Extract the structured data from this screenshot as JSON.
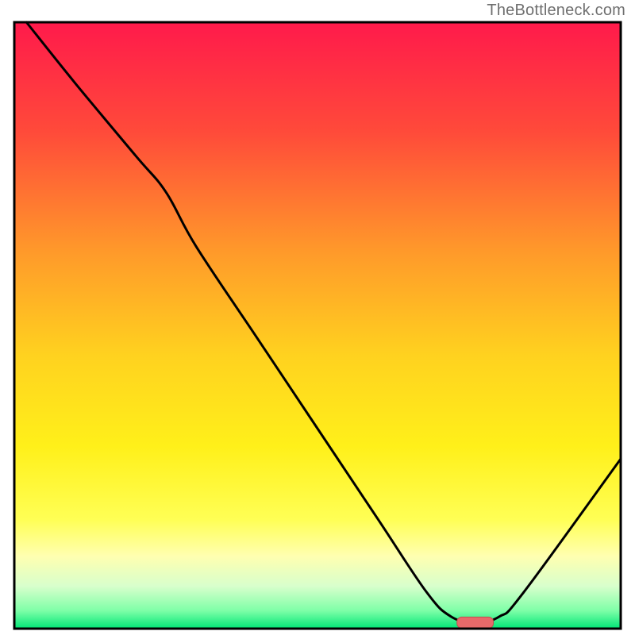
{
  "watermark": "TheBottleneck.com",
  "chart_data": {
    "type": "line",
    "title": "",
    "xlabel": "",
    "ylabel": "",
    "xlim": [
      0,
      100
    ],
    "ylim": [
      0,
      100
    ],
    "curve": {
      "name": "bottleneck-curve",
      "x": [
        2,
        10,
        20,
        25,
        30,
        40,
        50,
        60,
        68,
        72,
        76,
        80,
        84,
        100
      ],
      "y": [
        100,
        90,
        78,
        72,
        63,
        48,
        33,
        18,
        6,
        2,
        1,
        2,
        6,
        28
      ]
    },
    "optimum_marker": {
      "x_center": 76,
      "width": 6,
      "y": 1
    },
    "background": {
      "type": "vertical-gradient",
      "stops": [
        {
          "pos": 0.0,
          "color": "#ff1a4b"
        },
        {
          "pos": 0.18,
          "color": "#ff4a3a"
        },
        {
          "pos": 0.38,
          "color": "#ff9a2a"
        },
        {
          "pos": 0.55,
          "color": "#ffd21f"
        },
        {
          "pos": 0.7,
          "color": "#fff01a"
        },
        {
          "pos": 0.82,
          "color": "#ffff55"
        },
        {
          "pos": 0.88,
          "color": "#ffffb0"
        },
        {
          "pos": 0.93,
          "color": "#d8ffcc"
        },
        {
          "pos": 0.97,
          "color": "#7fffa8"
        },
        {
          "pos": 1.0,
          "color": "#00e676"
        }
      ]
    },
    "frame": {
      "color": "#000000",
      "width": 3
    },
    "line_style": {
      "stroke": "#000000",
      "width": 3
    },
    "marker_style": {
      "fill": "#e76a6a",
      "stroke": "#c24f4f"
    }
  }
}
